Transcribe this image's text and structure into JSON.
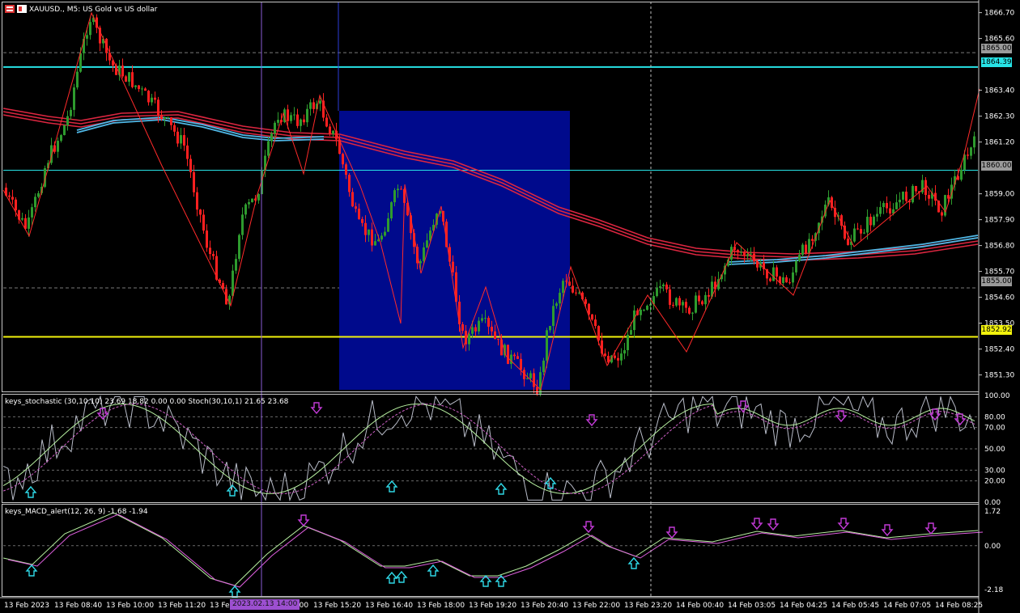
{
  "title": "XAUUSD., M5:  US Gold vs US dollar",
  "colors": {
    "bg": "#000000",
    "grid": "#5a5a5a",
    "bull": "#2e9b2e",
    "bear": "#ff2020",
    "zigzag": "#ff2a2a",
    "ema_red": "#dc2640",
    "ema_blue": "#4fb7e6",
    "box": "#000a8c",
    "cyan_line": "#27e3e6",
    "yellow_line": "#f2f20d",
    "crosshair_v": "#8a5cd6",
    "arrow_up": "#2fd8e6",
    "arrow_down": "#c23ad6"
  },
  "price_axis": {
    "ticks": [
      "1866.70",
      "1865.60",
      "1864.39",
      "1863.40",
      "1862.30",
      "1861.20",
      "1860.00",
      "1859.00",
      "1857.90",
      "1856.80",
      "1855.70",
      "1855.00",
      "1854.60",
      "1853.50",
      "1852.92",
      "1852.40",
      "1851.30"
    ],
    "badges": [
      {
        "text": "1865.00",
        "color": "#9a9a9a"
      },
      {
        "text": "1864.39",
        "color": "#27e3e6"
      },
      {
        "text": "1860.00",
        "color": "#9a9a9a"
      },
      {
        "text": "1855.00",
        "color": "#9a9a9a"
      },
      {
        "text": "1852.92",
        "color": "#f2f20d"
      }
    ]
  },
  "stoch": {
    "name": "keys_stochastic (30,10,10) 23.69 18.82 0.00 0.00 Stoch(30,10,1) 21.65 23.68",
    "ticks": [
      "100.00",
      "80.00",
      "70.00",
      "50.00",
      "30.00",
      "20.00",
      "0.00"
    ]
  },
  "macd": {
    "name": "keys_MACD_alert(12, 26, 9) -1.68 -1.94",
    "ticks": [
      "1.72",
      "0.00",
      "-2.18"
    ]
  },
  "time_axis": [
    "13 Feb 2023",
    "13 Feb 08:40",
    "13 Feb 10:00",
    "13 Feb 11:20",
    "13 Feb 12:40",
    "13 Feb 14:00",
    "13 Feb 15:20",
    "13 Feb 16:40",
    "13 Feb 18:00",
    "13 Feb 19:20",
    "13 Feb 20:40",
    "13 Feb 22:00",
    "13 Feb 23:20",
    "14 Feb 00:40",
    "14 Feb 03:05",
    "14 Feb 04:25",
    "14 Feb 05:45",
    "14 Feb 07:05",
    "14 Feb 08:25"
  ],
  "cursor_time": "2023.02.13 14:00"
}
